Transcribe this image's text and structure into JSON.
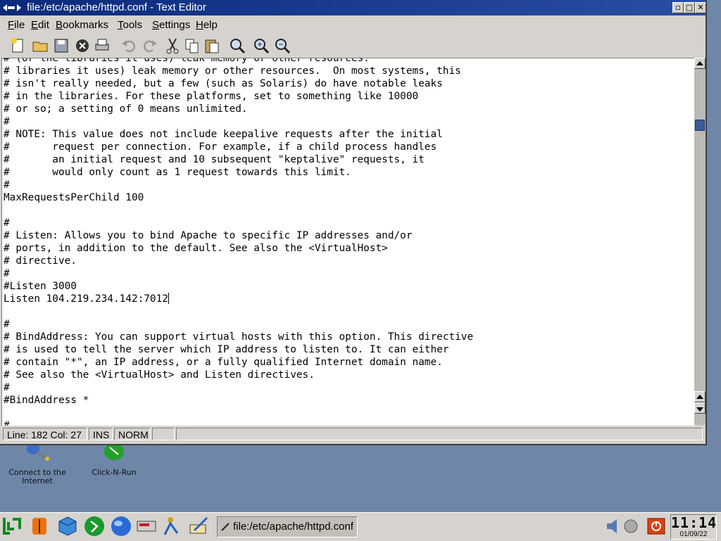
{
  "desktop": {
    "icons": [
      {
        "label_line1": "Connect to the",
        "label_line2": "Internet"
      },
      {
        "label_line1": "Click-N-Run",
        "label_line2": ""
      }
    ]
  },
  "window": {
    "title": "file:/etc/apache/httpd.conf - Text Editor",
    "buttons": {
      "minimize": "▫",
      "maximize": "□",
      "close": "✕"
    }
  },
  "menu": {
    "items": [
      "File",
      "Edit",
      "Bookmarks",
      "Tools",
      "Settings",
      "Help"
    ]
  },
  "toolbar": {
    "tools": [
      "new-file-icon",
      "open-folder-icon",
      "save-icon",
      "close-doc-icon",
      "print-icon",
      "undo-icon",
      "redo-icon",
      "cut-icon",
      "copy-icon",
      "paste-icon",
      "find-icon",
      "zoom-in-icon",
      "zoom-out-icon"
    ]
  },
  "editor": {
    "lines": [
      "# (or the libraries it uses) leak memory or other resources.",
      "# libraries it uses) leak memory or other resources.  On most systems, this",
      "# isn't really needed, but a few (such as Solaris) do have notable leaks",
      "# in the libraries. For these platforms, set to something like 10000",
      "# or so; a setting of 0 means unlimited.",
      "#",
      "# NOTE: This value does not include keepalive requests after the initial",
      "#       request per connection. For example, if a child process handles",
      "#       an initial request and 10 subsequent \"keptalive\" requests, it",
      "#       would only count as 1 request towards this limit.",
      "#",
      "MaxRequestsPerChild 100",
      "",
      "#",
      "# Listen: Allows you to bind Apache to specific IP addresses and/or",
      "# ports, in addition to the default. See also the <VirtualHost>",
      "# directive.",
      "#",
      "#Listen 3000",
      "Listen 104.219.234.142:7012",
      "",
      "#",
      "# BindAddress: You can support virtual hosts with this option. This directive",
      "# is used to tell the server which IP address to listen to. It can either",
      "# contain \"*\", an IP address, or a fully qualified Internet domain name.",
      "# See also the <VirtualHost> and Listen directives.",
      "#",
      "#BindAddress *",
      "",
      "#"
    ],
    "caret_line": 19
  },
  "status": {
    "position": "Line: 182 Col: 27",
    "mode": "INS",
    "state": "NORM",
    "extra": ""
  },
  "taskbar": {
    "task_label": "file:/etc/apache/httpd.conf",
    "clock_time": "11:14",
    "clock_date": "01/09/22"
  }
}
